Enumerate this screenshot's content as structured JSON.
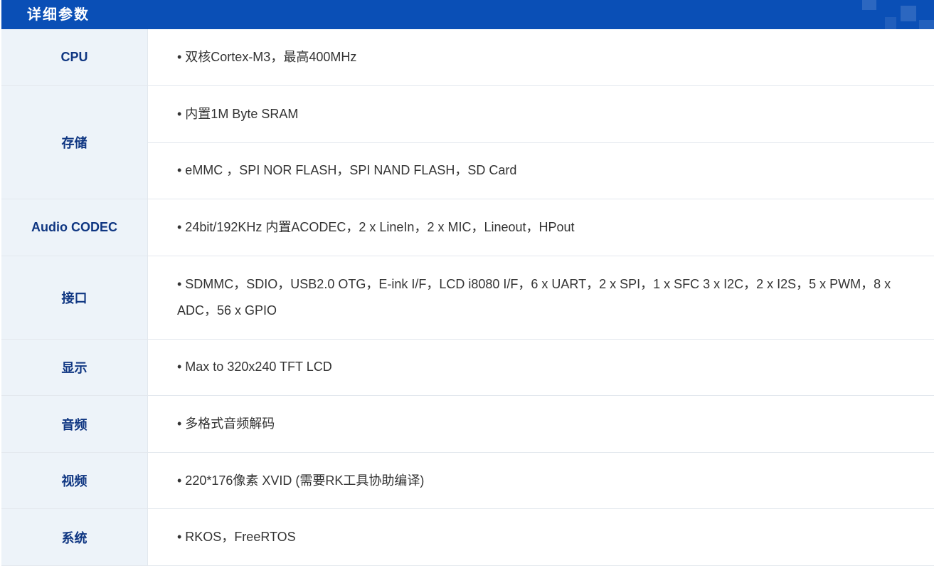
{
  "header": {
    "title": "详细参数"
  },
  "rows": [
    {
      "label": "CPU",
      "values": [
        "• 双核Cortex-M3，最高400MHz"
      ]
    },
    {
      "label": "存储",
      "values": [
        "• 内置1M Byte SRAM",
        "• eMMC ，SPI NOR FLASH，SPI NAND FLASH，SD Card"
      ]
    },
    {
      "label": "Audio CODEC",
      "values": [
        "• 24bit/192KHz 内置ACODEC，2 x LineIn，2 x MIC，Lineout，HPout"
      ]
    },
    {
      "label": "接口",
      "values": [
        "• SDMMC，SDIO，USB2.0 OTG，E-ink I/F，LCD i8080 I/F，6 x UART，2 x SPI，1 x SFC 3 x I2C，2 x I2S，5 x PWM，8 x ADC，56 x GPIO"
      ]
    },
    {
      "label": "显示",
      "values": [
        "• Max to 320x240 TFT LCD"
      ]
    },
    {
      "label": "音频",
      "values": [
        "• 多格式音频解码"
      ]
    },
    {
      "label": "视频",
      "values": [
        "• 220*176像素 XVID (需要RK工具协助编译)"
      ]
    },
    {
      "label": "系统",
      "values": [
        "• RKOS，FreeRTOS"
      ]
    }
  ],
  "colors": {
    "header_bg": "#0a4fb6",
    "label_bg": "#edf3f9",
    "label_text": "#0f3682",
    "value_text": "#333333"
  }
}
